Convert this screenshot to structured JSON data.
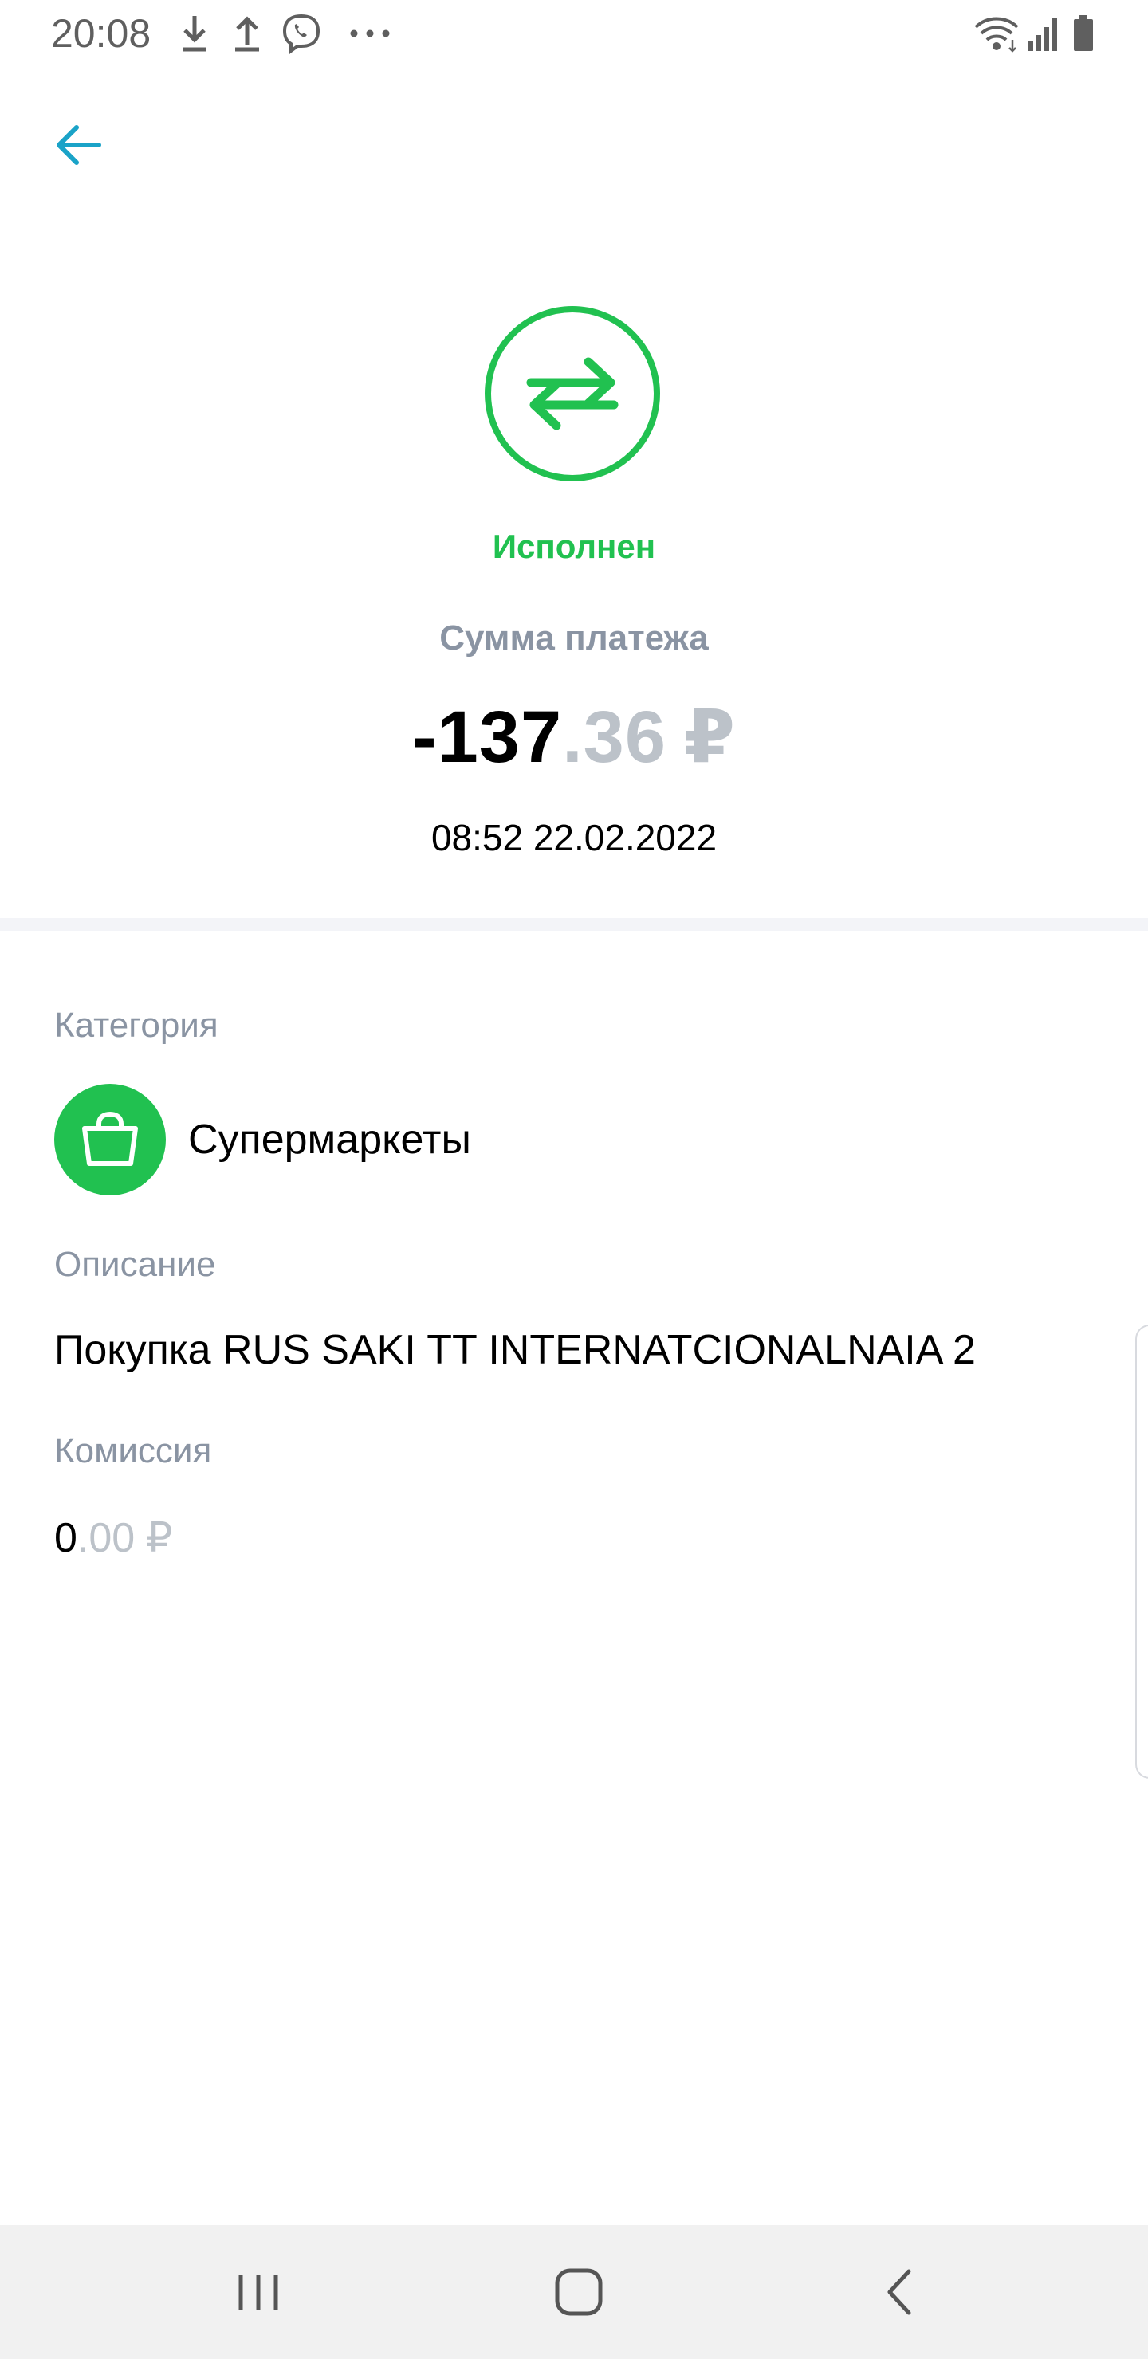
{
  "status_bar": {
    "time": "20:08",
    "icons": [
      "download-icon",
      "upload-icon",
      "viber-icon",
      "more-dots-icon",
      "wifi-icon",
      "signal-icon",
      "battery-icon"
    ]
  },
  "toolbar": {
    "back_icon": "arrow-left-icon"
  },
  "payment": {
    "status_icon": "exchange-arrows-icon",
    "status": "Исполнен",
    "amount_caption": "Сумма платежа",
    "amount_integer": "-137",
    "amount_fraction": ".36",
    "amount_currency": "₽",
    "timestamp": "08:52 22.02.2022"
  },
  "details": {
    "category_label": "Категория",
    "category_icon": "shopping-bag-icon",
    "category_name": "Супермаркеты",
    "description_label": "Описание",
    "description": "Покупка RUS SAKI TT INTERNATCIONALNAIA 2",
    "commission_label": "Комиссия",
    "commission_integer": "0",
    "commission_fraction": ".00",
    "commission_currency": "₽"
  },
  "nav_bar": {
    "items": [
      "recent-apps-icon",
      "home-icon",
      "back-icon"
    ]
  },
  "colors": {
    "accent_green": "#21c150",
    "back_arrow": "#1aa3c8",
    "muted_text": "#8a94a3",
    "faded_digits": "#bcc2c9"
  }
}
